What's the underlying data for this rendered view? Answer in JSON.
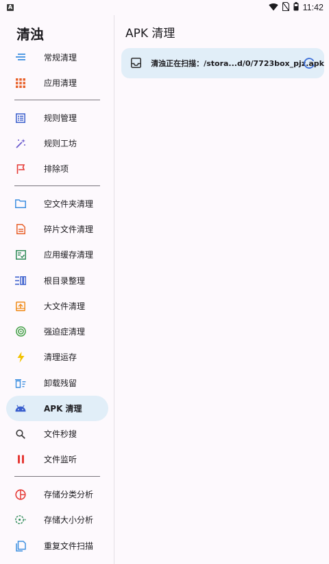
{
  "status_bar": {
    "notification_glyph": "A",
    "time": "11:42",
    "icons": [
      "wifi-icon",
      "no-sim-icon",
      "battery-icon"
    ]
  },
  "drawer": {
    "title": "清浊",
    "items": [
      {
        "label": "常规清理",
        "icon": "lines-icon",
        "color": "#3d8fe0"
      },
      {
        "label": "应用清理",
        "icon": "apps-grid-icon",
        "color": "#e8612a"
      },
      {
        "label": "规则管理",
        "icon": "list-box-icon",
        "color": "#3a5fcd"
      },
      {
        "label": "规则工坊",
        "icon": "magic-wand-icon",
        "color": "#6a5acd"
      },
      {
        "label": "排除项",
        "icon": "flag-icon",
        "color": "#e53935"
      },
      {
        "label": "空文件夹清理",
        "icon": "folder-icon",
        "color": "#3d8fe0"
      },
      {
        "label": "碎片文件清理",
        "icon": "document-icon",
        "color": "#e8612a"
      },
      {
        "label": "应用缓存清理",
        "icon": "checklist-icon",
        "color": "#2e8b57"
      },
      {
        "label": "根目录整理",
        "icon": "columns-icon",
        "color": "#3a5fcd"
      },
      {
        "label": "大文件清理",
        "icon": "archive-box-icon",
        "color": "#f08c1a"
      },
      {
        "label": "强迫症清理",
        "icon": "radar-icon",
        "color": "#43a047"
      },
      {
        "label": "清理运存",
        "icon": "lightning-icon",
        "color": "#f2c200"
      },
      {
        "label": "卸载残留",
        "icon": "trash-list-icon",
        "color": "#3d8fe0"
      },
      {
        "label": "APK 清理",
        "icon": "android-icon",
        "color": "#3a5fcd"
      },
      {
        "label": "文件秒搜",
        "icon": "search-icon",
        "color": "#3a3a3a"
      },
      {
        "label": "文件监听",
        "icon": "pause-icon",
        "color": "#e53935"
      },
      {
        "label": "存储分类分析",
        "icon": "pie-chart-icon",
        "color": "#e53935"
      },
      {
        "label": "存储大小分析",
        "icon": "target-dots-icon",
        "color": "#2e8b57"
      },
      {
        "label": "重复文件扫描",
        "icon": "copy-files-icon",
        "color": "#3d8fe0"
      }
    ],
    "active_label": "APK 清理"
  },
  "main": {
    "title": "APK 清理",
    "scan_status": "清浊正在扫描：/stora...d/0/7723box_pjz.apk",
    "accent_color": "#3d6fd8",
    "card_color": "#e1eef8"
  }
}
